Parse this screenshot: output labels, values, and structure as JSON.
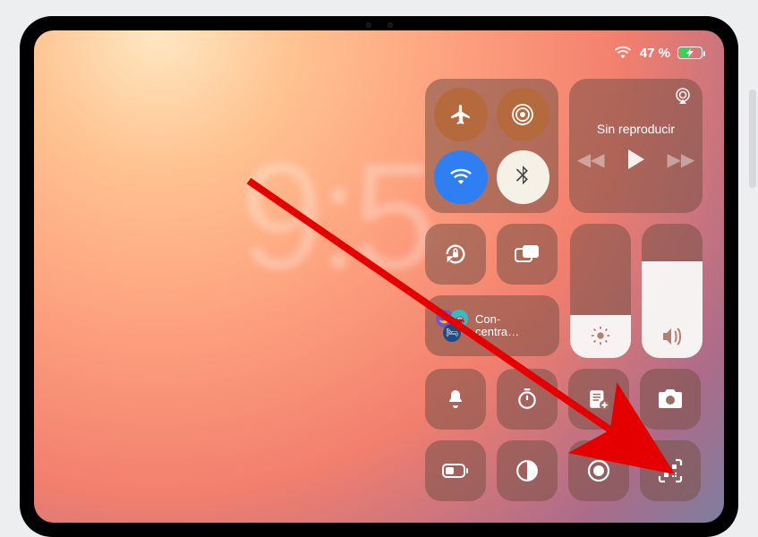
{
  "status": {
    "battery_pct": "47 %",
    "battery_level": 0.47,
    "wifi_on": true,
    "charging": true
  },
  "clock": {
    "partial_time": "9:5"
  },
  "control_center": {
    "connectivity": {
      "airplane": {
        "name": "airplane-icon",
        "on": false
      },
      "airdrop": {
        "name": "airdrop-icon",
        "on": false
      },
      "wifi": {
        "name": "wifi-icon",
        "on": true
      },
      "bluetooth": {
        "name": "bluetooth-icon",
        "on": true
      }
    },
    "media": {
      "title": "Sin reproducir",
      "airplay_icon": "airplay-icon"
    },
    "row2": {
      "orientation_lock": "orientation-lock-icon",
      "screen_mirroring": "screen-mirroring-icon",
      "brightness_level": 0.32,
      "volume_level": 0.72,
      "focus_label": "Con-\ncentra…"
    },
    "small_buttons": [
      {
        "name": "silent-icon",
        "glyph": "bell"
      },
      {
        "name": "timer-icon",
        "glyph": "timer"
      },
      {
        "name": "notes-icon",
        "glyph": "notes-plus"
      },
      {
        "name": "camera-icon",
        "glyph": "camera"
      },
      {
        "name": "low-power-icon",
        "glyph": "battery-half"
      },
      {
        "name": "dark-mode-icon",
        "glyph": "half-circle"
      },
      {
        "name": "screen-record-icon",
        "glyph": "record"
      },
      {
        "name": "qr-scan-icon",
        "glyph": "qr"
      }
    ]
  },
  "annotation": {
    "arrow_target": "qr-scan-icon"
  }
}
